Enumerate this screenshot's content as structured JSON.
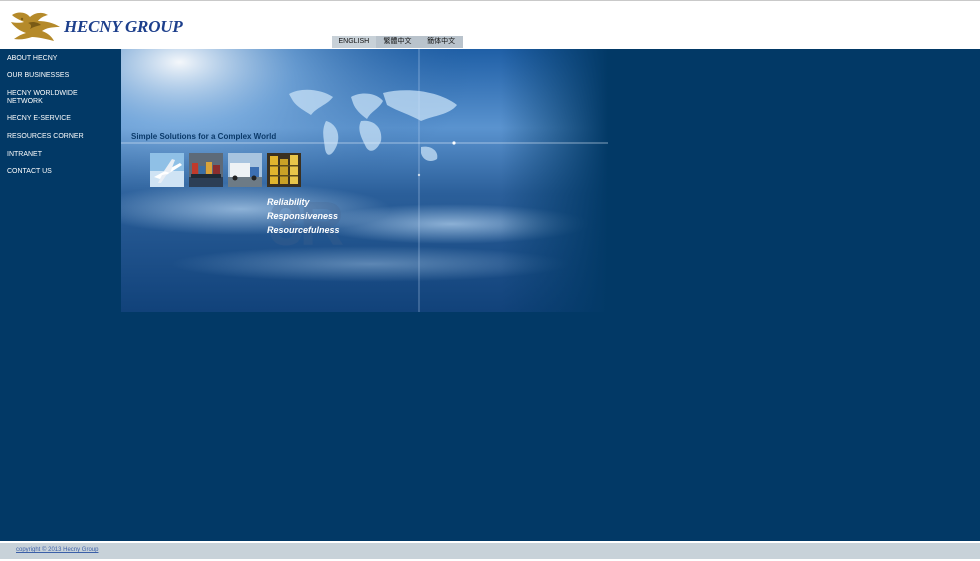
{
  "header": {
    "logo_text": "HECNY GROUP",
    "languages": [
      "ENGLISH",
      "繁體中文",
      "簡体中文"
    ]
  },
  "sidebar": {
    "items": [
      {
        "label": "ABOUT HECNY"
      },
      {
        "label": "OUR BUSINESSES"
      },
      {
        "label": "HECNY WORLDWIDE NETWORK"
      },
      {
        "label": "HECNY E-SERVICE"
      },
      {
        "label": "RESOURCES CORNER"
      },
      {
        "label": "INTRANET"
      },
      {
        "label": "CONTACT US"
      }
    ]
  },
  "hero": {
    "tagline": "Simple Solutions for a Complex World",
    "values": [
      "Reliability",
      "Responsiveness",
      "Resourcefulness"
    ],
    "watermark": "3R",
    "photos": [
      "airplane-photo",
      "ship-photo",
      "truck-photo",
      "warehouse-photo"
    ]
  },
  "footer": {
    "copyright": "copyright © 2013 Hecny Group"
  },
  "colors": {
    "page_background": "#023966",
    "footer_background": "#c8d2d9",
    "brand_blue": "#1d3f8c",
    "logo_gold": "#b58a2a"
  }
}
